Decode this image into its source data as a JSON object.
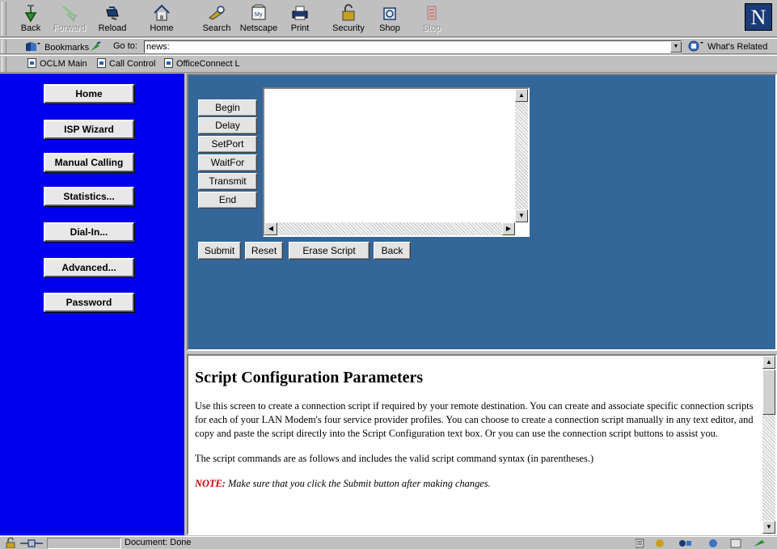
{
  "toolbar": {
    "buttons": [
      {
        "label": "Back",
        "icon": "back-arrow-icon",
        "enabled": true
      },
      {
        "label": "Forward",
        "icon": "forward-arrow-icon",
        "enabled": false
      },
      {
        "label": "Reload",
        "icon": "reload-icon",
        "enabled": true
      },
      {
        "label": "Home",
        "icon": "home-icon",
        "enabled": true
      },
      {
        "label": "Search",
        "icon": "search-icon",
        "enabled": true
      },
      {
        "label": "Netscape",
        "icon": "netscape-icon",
        "enabled": true
      },
      {
        "label": "Print",
        "icon": "print-icon",
        "enabled": true
      },
      {
        "label": "Security",
        "icon": "security-lock-icon",
        "enabled": true
      },
      {
        "label": "Shop",
        "icon": "shop-icon",
        "enabled": true
      },
      {
        "label": "Stop",
        "icon": "stop-icon",
        "enabled": false
      }
    ],
    "netscape_icon_label": "My",
    "logo_letter": "N"
  },
  "location_bar": {
    "bookmarks_label": "Bookmarks",
    "goto_label": "Go to:",
    "url": "news:",
    "whats_related_label": "What's Related"
  },
  "personal_toolbar": {
    "items": [
      "OCLM Main",
      "Call Control",
      "OfficeConnect L"
    ]
  },
  "sidebar": {
    "items": [
      {
        "label": "Home"
      },
      {
        "label": "ISP Wizard"
      },
      {
        "label": "Manual Calling"
      },
      {
        "label": "Statistics..."
      },
      {
        "label": "Dial-In..."
      },
      {
        "label": "Advanced..."
      },
      {
        "label": "Password"
      }
    ],
    "background": "#0000ee"
  },
  "script_panel": {
    "command_buttons": [
      "Begin",
      "Delay",
      "SetPort",
      "WaitFor",
      "Transmit",
      "End"
    ],
    "script_text": "",
    "form_buttons": {
      "submit": "Submit",
      "reset": "Reset",
      "erase": "Erase Script",
      "back": "Back"
    },
    "background": "#336699"
  },
  "help": {
    "title": "Script Configuration Parameters",
    "paragraph1": "Use this screen to create a connection script if required by your remote destination. You can create and associate specific connection scripts for each of your LAN Modem's four service provider profiles.  You can choose to create a connection script manually in any text editor, and copy and paste the script directly into the Script Configuration text box.  Or you can use the connection script buttons to assist you.",
    "paragraph2": "The script commands are as follows and includes the valid script command syntax (in parentheses.)",
    "note_label": "NOTE:",
    "note_text": "Make sure that you click the Submit button after making changes."
  },
  "status_bar": {
    "text": "Document: Done"
  }
}
